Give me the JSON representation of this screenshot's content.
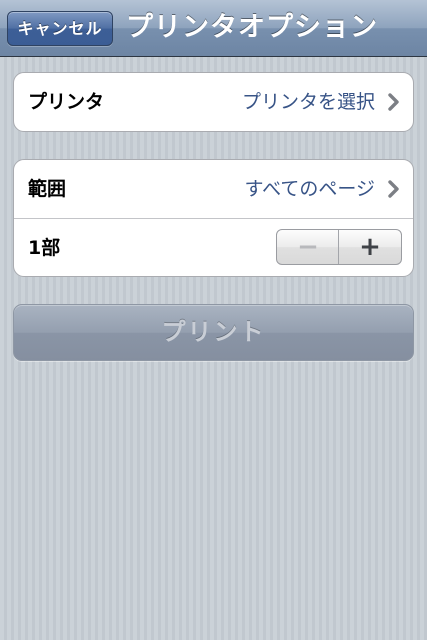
{
  "navbar": {
    "cancel_label": "キャンセル",
    "title": "プリンタオプション"
  },
  "printer_group": {
    "label": "プリンタ",
    "value": "プリンタを選択",
    "icon": "chevron-right-icon"
  },
  "options_group": {
    "range_label": "範囲",
    "range_value": "すべてのページ",
    "range_icon": "chevron-right-icon",
    "copies_label": "1部",
    "stepper_minus": "−",
    "stepper_plus": "+"
  },
  "print_button": {
    "label": "プリント",
    "enabled": false
  },
  "colors": {
    "navbar": "#6d85a4",
    "value_text": "#385487",
    "background": "#c5ccd4"
  }
}
